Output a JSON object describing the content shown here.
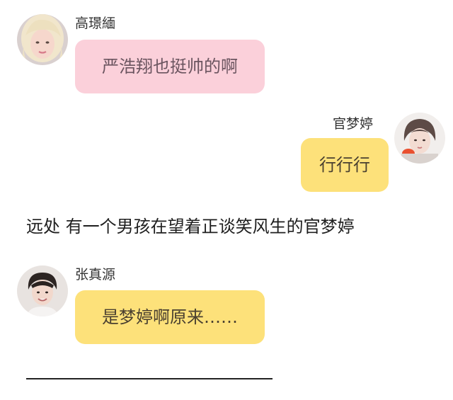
{
  "messages": [
    {
      "sender": "高璟緬",
      "text": "严浩翔也挺帅的啊",
      "side": "left",
      "bubble_color": "#fbd0da",
      "avatar": "girl-blonde-avatar"
    },
    {
      "sender": "官梦婷",
      "text": "行行行",
      "side": "right",
      "bubble_color": "#fde17a",
      "avatar": "girl-short-hair-avatar"
    },
    {
      "sender": "张真源",
      "text": "是梦婷啊原来……",
      "side": "left",
      "bubble_color": "#fde17a",
      "avatar": "boy-avatar"
    }
  ],
  "narration": "远处 有一个男孩在望着正谈笑风生的官梦婷"
}
